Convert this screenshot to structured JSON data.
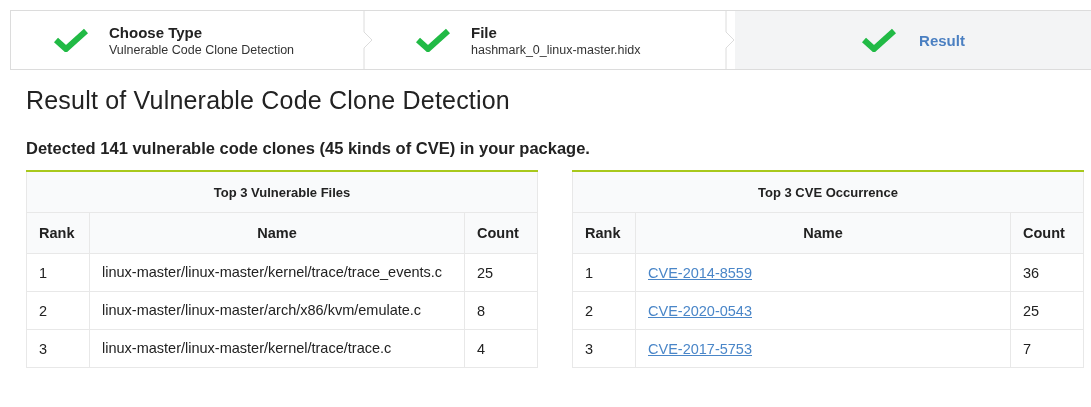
{
  "steps": [
    {
      "title": "Choose Type",
      "description": "Vulnerable Code Clone Detection",
      "completed": true,
      "selected": false
    },
    {
      "title": "File",
      "description": "hashmark_0_linux-master.hidx",
      "completed": true,
      "selected": false
    },
    {
      "title": "Result",
      "completed": true,
      "selected": true
    }
  ],
  "heading": "Result of Vulnerable Code Clone Detection",
  "summary": "Detected 141 vulnerable code clones (45 kinds of CVE) in your package.",
  "tables": [
    {
      "title": "Top 3 Vulnerable Files",
      "columns": [
        "Rank",
        "Name",
        "Count"
      ],
      "rows": [
        {
          "rank": "1",
          "name": "linux-master/linux-master/kernel/trace/trace_events.c",
          "count": "25",
          "link": false
        },
        {
          "rank": "2",
          "name": "linux-master/linux-master/arch/x86/kvm/emulate.c",
          "count": "8",
          "link": false
        },
        {
          "rank": "3",
          "name": "linux-master/linux-master/kernel/trace/trace.c",
          "count": "4",
          "link": false
        }
      ]
    },
    {
      "title": "Top 3 CVE Occurrence",
      "columns": [
        "Rank",
        "Name",
        "Count"
      ],
      "rows": [
        {
          "rank": "1",
          "name": "CVE-2014-8559",
          "count": "36",
          "link": true
        },
        {
          "rank": "2",
          "name": "CVE-2020-0543",
          "count": "25",
          "link": true
        },
        {
          "rank": "3",
          "name": "CVE-2017-5753",
          "count": "7",
          "link": true
        }
      ]
    }
  ]
}
